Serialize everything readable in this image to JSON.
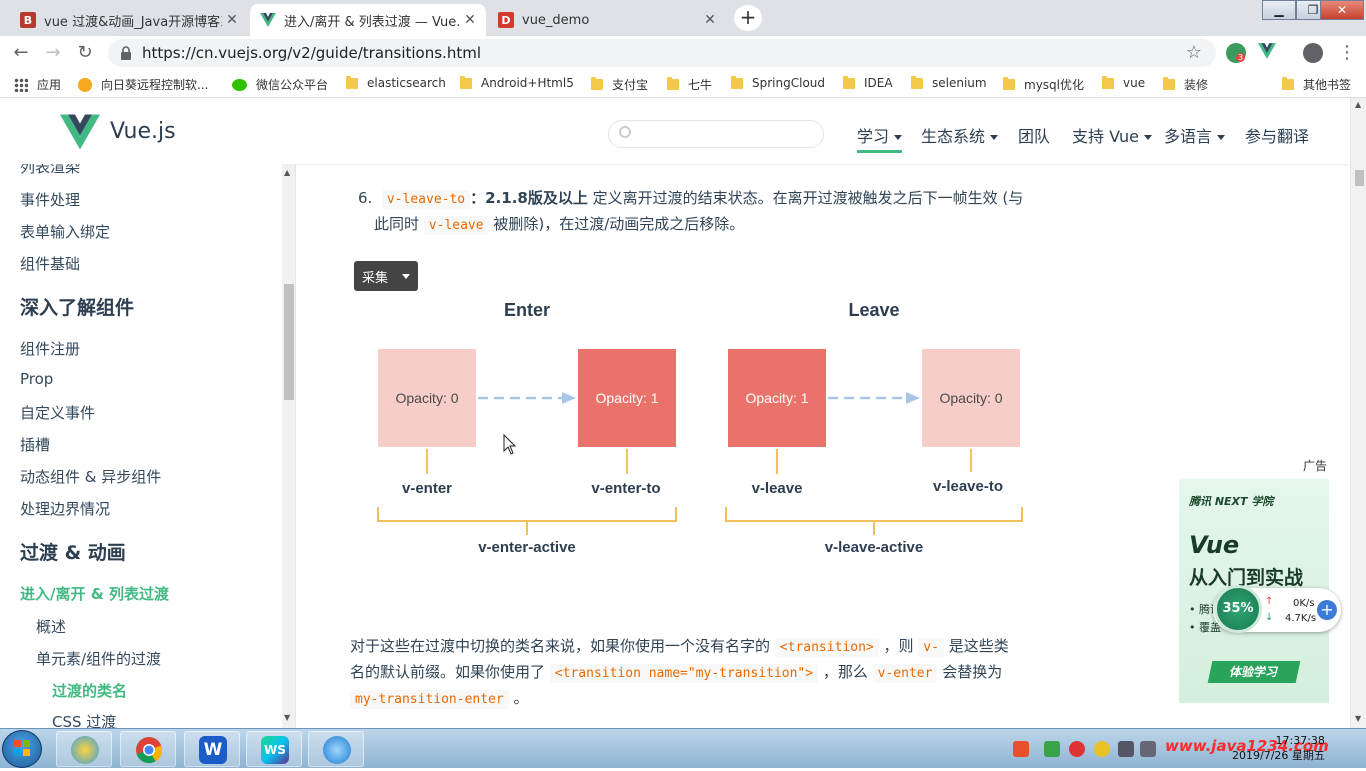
{
  "browser": {
    "tabs": [
      {
        "title": "vue 过渡&动画_Java开源博客系",
        "icon": "B",
        "icon_color": "#c0392b",
        "active": false
      },
      {
        "title": "进入/离开 & 列表过渡 — Vue.js",
        "icon": "vue-logo",
        "icon_color": "#42b983",
        "active": true
      },
      {
        "title": "vue_demo",
        "icon": "D",
        "icon_color": "#e74c3c",
        "active": false
      }
    ],
    "new_tab": "+",
    "url": "https://cn.vuejs.org/v2/guide/transitions.html",
    "extension_badge": "3",
    "bookmarks": [
      {
        "label": "应用",
        "icon": "apps-grid-icon"
      },
      {
        "label": "向日葵远程控制软...",
        "icon": "sunflower-icon"
      },
      {
        "label": "微信公众平台",
        "icon": "wechat-icon"
      },
      {
        "label": "elasticsearch",
        "icon": "folder-icon"
      },
      {
        "label": "Android+Html5",
        "icon": "folder-icon"
      },
      {
        "label": "支付宝",
        "icon": "folder-icon"
      },
      {
        "label": "七牛",
        "icon": "folder-icon"
      },
      {
        "label": "SpringCloud",
        "icon": "folder-icon"
      },
      {
        "label": "IDEA",
        "icon": "folder-icon"
      },
      {
        "label": "selenium",
        "icon": "folder-icon"
      },
      {
        "label": "mysql优化",
        "icon": "folder-icon"
      },
      {
        "label": "vue",
        "icon": "folder-icon"
      },
      {
        "label": "装修",
        "icon": "folder-icon"
      }
    ],
    "other_bookmarks": "其他书签"
  },
  "site": {
    "logo_text": "Vue.js",
    "search_placeholder": "",
    "nav": [
      {
        "label": "学习",
        "dropdown": true,
        "current": true
      },
      {
        "label": "生态系统",
        "dropdown": true,
        "current": false
      },
      {
        "label": "团队",
        "dropdown": false,
        "current": false
      },
      {
        "label": "支持 Vue",
        "dropdown": true,
        "current": false
      },
      {
        "label": "多语言",
        "dropdown": true,
        "current": false
      },
      {
        "label": "参与翻译",
        "dropdown": false,
        "current": false
      }
    ]
  },
  "sidebar": {
    "items": [
      {
        "label": "列表渲染",
        "level": "l1"
      },
      {
        "label": "事件处理",
        "level": "l1"
      },
      {
        "label": "表单输入绑定",
        "level": "l1"
      },
      {
        "label": "组件基础",
        "level": "l1"
      },
      {
        "label": "深入了解组件",
        "level": "h"
      },
      {
        "label": "组件注册",
        "level": "l1"
      },
      {
        "label": "Prop",
        "level": "l1"
      },
      {
        "label": "自定义事件",
        "level": "l1"
      },
      {
        "label": "插槽",
        "level": "l1"
      },
      {
        "label": "动态组件 & 异步组件",
        "level": "l1"
      },
      {
        "label": "处理边界情况",
        "level": "l1"
      },
      {
        "label": "过渡 & 动画",
        "level": "h"
      },
      {
        "label": "进入/离开 & 列表过渡",
        "level": "l1",
        "active": true
      },
      {
        "label": "概述",
        "level": "l2"
      },
      {
        "label": "单元素/组件的过渡",
        "level": "l2"
      },
      {
        "label": "过渡的类名",
        "level": "l3",
        "active": true
      },
      {
        "label": "CSS 过渡",
        "level": "l3"
      }
    ]
  },
  "content": {
    "item_number": "6.",
    "item_code": "v-leave-to",
    "item_version": "：2.1.8版及以上",
    "item_text_1": "定义离开过渡的结束状态。在离开过渡被触发之后下一帧生效 (与",
    "item_text_2a": "此同时",
    "item_code_2": "v-leave",
    "item_text_2b": "被删除)，在过渡/动画完成之后移除。",
    "collect_button": "采集",
    "para_1a": "对于这些在过渡中切换的类名来说，如果你使用一个没有名字的",
    "para_code_1": "<transition>",
    "para_1b": "，则",
    "para_code_2": "v-",
    "para_1c": "是这些类",
    "para_2a": "名的默认前缀。如果你使用了",
    "para_code_3": "<transition name=\"my-transition\">",
    "para_2b": "，那么",
    "para_code_4": "v-enter",
    "para_2c": "会替换为",
    "para_code_5": "my-transition-enter",
    "para_3": "。"
  },
  "diagram": {
    "enter_title": "Enter",
    "leave_title": "Leave",
    "boxes": [
      "Opacity: 0",
      "Opacity: 1",
      "Opacity: 1",
      "Opacity: 0"
    ],
    "labels": [
      "v-enter",
      "v-enter-to",
      "v-leave",
      "v-leave-to"
    ],
    "active_labels": [
      "v-enter-active",
      "v-leave-active"
    ],
    "colors": {
      "light": "#f6cdc9",
      "dark": "#e9736b",
      "bracket": "#f2c05a",
      "arrow": "#a8c6e6",
      "title": "#2c3e50"
    }
  },
  "ad": {
    "label": "广告",
    "brand": "腾讯 NEXT 学院",
    "headline": "Vue",
    "subheadline": "从入门到实战",
    "bullets": [
      "腾讯",
      "覆盖"
    ],
    "cta": "体验学习"
  },
  "speed_widget": {
    "percent": "35%",
    "up": "0K/s",
    "down": "4.7K/s"
  },
  "taskbar": {
    "apps": [
      "360-browser",
      "chrome",
      "wps",
      "webstorm",
      "browser"
    ],
    "time": "17:37:38",
    "date": "2019/7/26 星期五",
    "watermark": "www.java1234.com"
  }
}
